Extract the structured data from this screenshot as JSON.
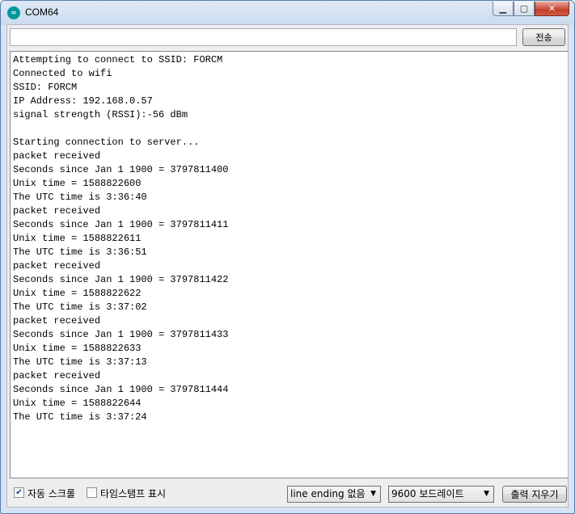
{
  "window": {
    "title": "COM64",
    "minimize": "▁",
    "maximize": "▢",
    "close": "✕"
  },
  "send_bar": {
    "input_value": "",
    "input_placeholder": "",
    "send_label": "전송"
  },
  "serial_output": [
    "Attempting to connect to SSID: FORCM",
    "Connected to wifi",
    "SSID: FORCM",
    "IP Address: 192.168.0.57",
    "signal strength (RSSI):-56 dBm",
    "",
    "Starting connection to server...",
    "packet received",
    "Seconds since Jan 1 1900 = 3797811400",
    "Unix time = 1588822600",
    "The UTC time is 3:36:40",
    "packet received",
    "Seconds since Jan 1 1900 = 3797811411",
    "Unix time = 1588822611",
    "The UTC time is 3:36:51",
    "packet received",
    "Seconds since Jan 1 1900 = 3797811422",
    "Unix time = 1588822622",
    "The UTC time is 3:37:02",
    "packet received",
    "Seconds since Jan 1 1900 = 3797811433",
    "Unix time = 1588822633",
    "The UTC time is 3:37:13",
    "packet received",
    "Seconds since Jan 1 1900 = 3797811444",
    "Unix time = 1588822644",
    "The UTC time is 3:37:24"
  ],
  "bottom_bar": {
    "autoscroll_label": "자동 스크롤",
    "autoscroll_checked": true,
    "timestamp_label": "타임스탬프 표시",
    "timestamp_checked": false,
    "line_ending_value": "line ending 없음",
    "baud_rate_value": "9600 보드레이트",
    "clear_label": "출력 지우기"
  },
  "colors": {
    "app_icon": "#00979c",
    "close_button": "#c4402d"
  }
}
